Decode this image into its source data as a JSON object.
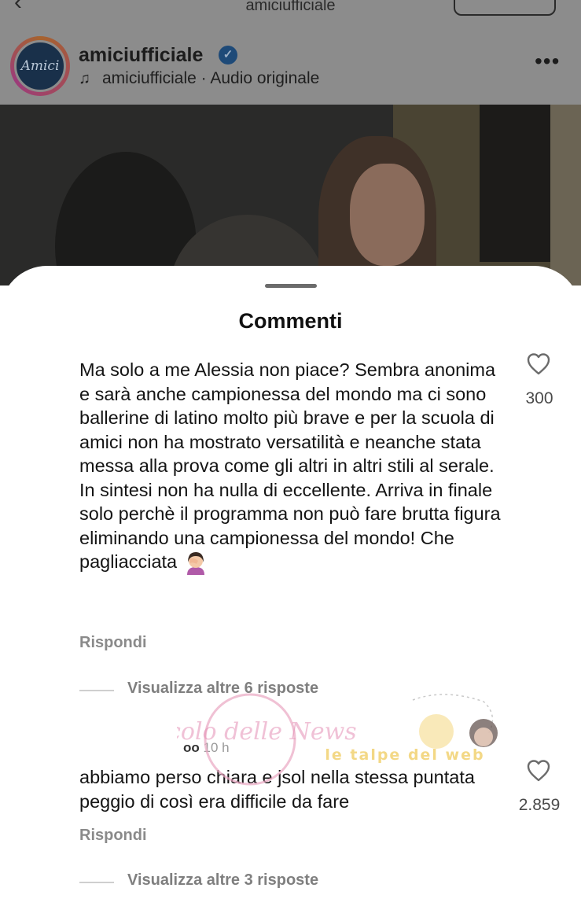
{
  "top_bar": {
    "username": "amiciufficiale"
  },
  "post": {
    "avatar_text": "Amici",
    "username": "amiciufficiale",
    "audio_artist": "amiciufficiale",
    "audio_separator": "·",
    "audio_label": "Audio originale"
  },
  "sheet": {
    "title": "Commenti"
  },
  "comments": [
    {
      "text": "Ma solo a me Alessia non piace? Sembra anonima e sarà anche campionessa del mondo ma ci sono ballerine di latino molto più brave e per la scuola di amici non ha mostrato versatilità e neanche stata messa alla prova come gli altri in altri stili al serale. In sintesi non ha nulla di eccellente. Arriva in finale solo perchè il programma non può fare brutta figura eliminando una campionessa del mondo! Che pagliacciata",
      "emoji": "woman-facepalming-icon",
      "likes": "300",
      "reply": "Rispondi",
      "more_replies": "Visualizza altre 6 risposte"
    },
    {
      "author": "oo",
      "time": "10 h",
      "text": "abbiamo perso chiara e jsol nella stessa puntata peggio di così era difficile da fare",
      "likes": "2.859",
      "reply": "Rispondi",
      "more_replies": "Visualizza altre 3 risposte"
    }
  ],
  "watermark": {
    "left": "Vicolo delle News",
    "right": "le talpe del web"
  },
  "colors": {
    "dim_overlay": "#8c8c8c",
    "verified": "#1e4a78",
    "secondary_text": "#8a8a8a"
  }
}
